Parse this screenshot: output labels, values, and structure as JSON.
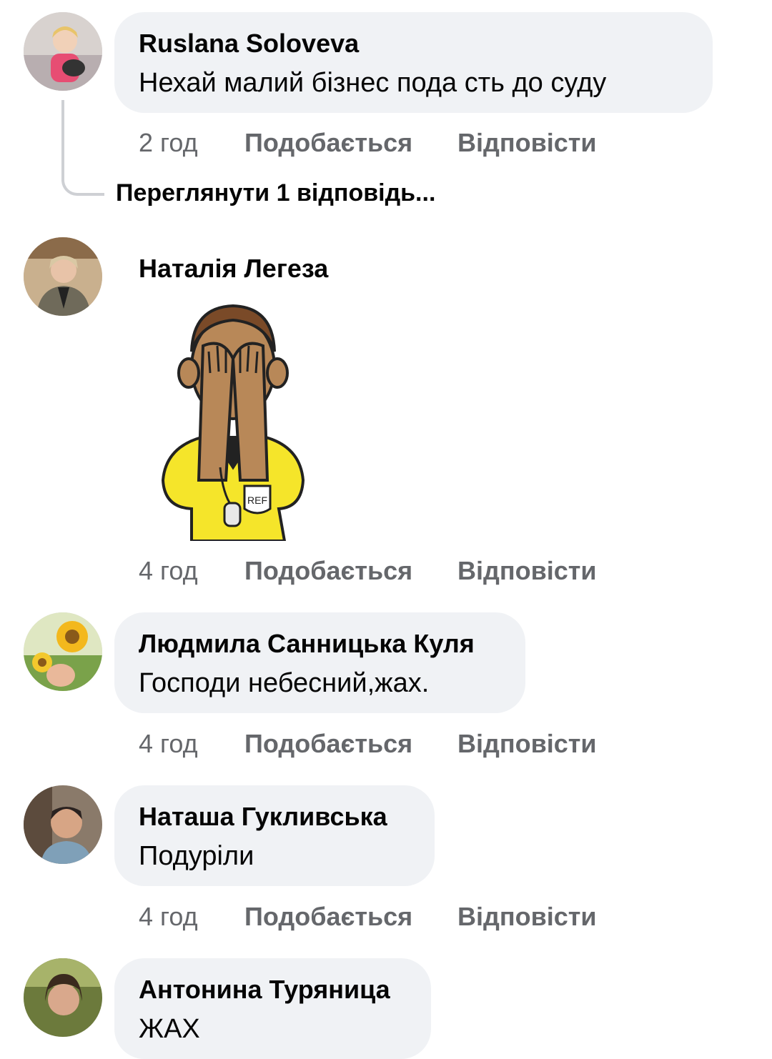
{
  "comments": [
    {
      "author": "Ruslana  Soloveva",
      "text": "Нехай малий бізнес  пода сть до суду",
      "time": "2 год",
      "like_label": "Подобається",
      "reply_label": "Відповісти",
      "view_replies": "Переглянути 1 відповідь..."
    },
    {
      "author": "Наталія Легеза",
      "sticker_text": "REF",
      "time": "4 год",
      "like_label": "Подобається",
      "reply_label": "Відповісти"
    },
    {
      "author": "Людмила Санницька Куля",
      "text": "Господи небесний,жах.",
      "time": "4 год",
      "like_label": "Подобається",
      "reply_label": "Відповісти"
    },
    {
      "author": "Наташа Гукливська",
      "text": "Подуріли",
      "time": "4 год",
      "like_label": "Подобається",
      "reply_label": "Відповісти"
    },
    {
      "author": "Антонина Туряница",
      "text": "ЖАХ"
    }
  ],
  "colors": {
    "bubble": "#f0f2f5",
    "secondary_text": "#65676b",
    "thread_line": "#ced0d4",
    "sticker_shirt": "#f5e52a"
  }
}
